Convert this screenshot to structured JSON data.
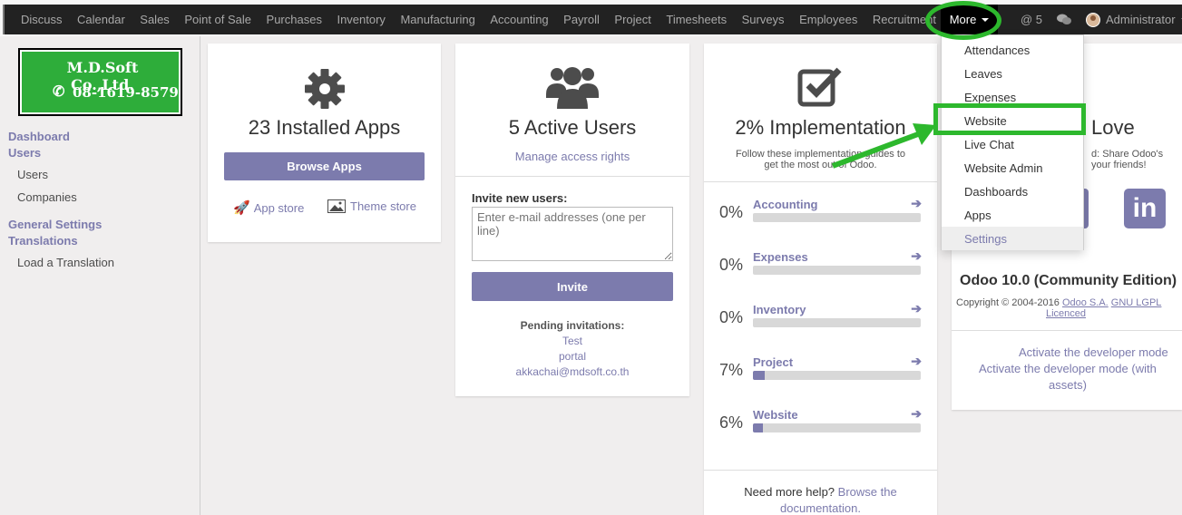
{
  "topbar": {
    "menu": [
      "Discuss",
      "Calendar",
      "Sales",
      "Point of Sale",
      "Purchases",
      "Inventory",
      "Manufacturing",
      "Accounting",
      "Payroll",
      "Project",
      "Timesheets",
      "Surveys",
      "Employees",
      "Recruitment"
    ],
    "more_label": "More",
    "mentions": "@ 5",
    "user": "Administrator"
  },
  "logo": {
    "name": "M.D.Soft Co.,Ltd.",
    "phone": "08-1619-8579"
  },
  "sidebar": {
    "dashboard": "Dashboard",
    "users_head": "Users",
    "users": "Users",
    "companies": "Companies",
    "general_settings": "General Settings",
    "translations": "Translations",
    "load_translation": "Load a Translation"
  },
  "apps_card": {
    "title": "23 Installed Apps",
    "browse": "Browse Apps",
    "app_store": "App store",
    "theme_store": "Theme store"
  },
  "users_card": {
    "title": "5 Active Users",
    "manage": "Manage access rights",
    "invite_label": "Invite new users:",
    "invite_placeholder": "Enter e-mail addresses (one per line)",
    "invite_button": "Invite",
    "pending_label": "Pending invitations:",
    "pending": [
      "Test",
      "portal",
      "akkachai@mdsoft.co.th"
    ]
  },
  "impl_card": {
    "title": "2% Implementation",
    "subtitle_1": "Follow these implementation guides to",
    "subtitle_2": "get the most out of Odoo.",
    "rows": [
      {
        "pct": "0%",
        "name": "Accounting",
        "value": 0
      },
      {
        "pct": "0%",
        "name": "Expenses",
        "value": 0
      },
      {
        "pct": "0%",
        "name": "Inventory",
        "value": 0
      },
      {
        "pct": "7%",
        "name": "Project",
        "value": 7
      },
      {
        "pct": "6%",
        "name": "Website",
        "value": 6
      }
    ],
    "help_1": "Need more help?",
    "help_link_1": "Browse the",
    "help_link_2": "documentation."
  },
  "share_card": {
    "title_fragment": "Love",
    "sub_1": "d: Share Odoo's",
    "sub_2": "your friends!",
    "version": "Odoo 10.0 (Community Edition)",
    "copyright": "Copyright © 2004-2016",
    "odoo_sa": "Odoo S.A.",
    "license": "GNU LGPL",
    "licenced": "Licenced",
    "dev_mode": "Activate the developer mode",
    "dev_mode_assets_1": "Activate the developer mode (with",
    "dev_mode_assets_2": "assets)"
  },
  "dropdown": {
    "items": [
      "Attendances",
      "Leaves",
      "Expenses",
      "Website",
      "Live Chat",
      "Website Admin",
      "Dashboards",
      "Apps",
      "Settings"
    ],
    "active": "Settings"
  },
  "colors": {
    "accent": "#7c7bad",
    "annotation": "#2db82d",
    "topbar": "#222222"
  }
}
